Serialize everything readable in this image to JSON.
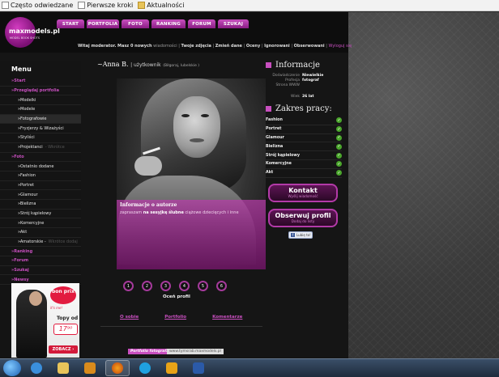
{
  "bookmarks": [
    {
      "label": "Często odwiedzane",
      "icon": "page-icon"
    },
    {
      "label": "Pierwsze kroki",
      "icon": "page-icon"
    },
    {
      "label": "Aktualności",
      "icon": "folder-icon"
    }
  ],
  "logo": {
    "text": "maxmodels.pl",
    "sub": "MODEL BOOK SHOTS"
  },
  "topnav": [
    "START",
    "PORTFOLIA",
    "FOTO",
    "RANKING",
    "FORUM",
    "SZUKAJ"
  ],
  "userbar": {
    "greeting": "Witaj moderator.",
    "msg": "Masz 0 nowych",
    "msg_link": "wiadomości",
    "links": [
      "Twoje zdjęcia",
      "Zmień dane",
      "Oceny",
      "Ignorowani",
      "Obserwowani"
    ],
    "logout": "Wyloguj się"
  },
  "sidebar": {
    "title": "Menu",
    "items": [
      {
        "label": "»Start",
        "type": "sec"
      },
      {
        "label": "»Przeglądaj portfolia",
        "type": "sec"
      },
      {
        "label": "»Modelki",
        "type": "sub"
      },
      {
        "label": "»Modele",
        "type": "sub"
      },
      {
        "label": "»Fotografowie",
        "type": "sub"
      },
      {
        "label": "»Fryzjerzy & Wizażyści",
        "type": "sub"
      },
      {
        "label": "»Styliści",
        "type": "sub"
      },
      {
        "label": "»Projektanci",
        "type": "sub",
        "note": "- Wkrótce"
      },
      {
        "label": "»Foto",
        "type": "sec"
      },
      {
        "label": "»Ostatnio dodane",
        "type": "sub2"
      },
      {
        "label": "»Fashion",
        "type": "sub2"
      },
      {
        "label": "»Portret",
        "type": "sub2"
      },
      {
        "label": "»Glamour",
        "type": "sub2"
      },
      {
        "label": "»Bielizna",
        "type": "sub2"
      },
      {
        "label": "»Strój kąpielowy",
        "type": "sub2"
      },
      {
        "label": "»Komercyjne",
        "type": "sub2"
      },
      {
        "label": "»Akt",
        "type": "sub2"
      },
      {
        "label": "»Amatorskie -",
        "type": "sub2",
        "note": "Wkrótce dodaj"
      },
      {
        "label": "»Ranking",
        "type": "sec"
      },
      {
        "label": "»Forum",
        "type": "sec"
      },
      {
        "label": "»Szukaj",
        "type": "sec"
      },
      {
        "label": "»Newsy",
        "type": "sec"
      }
    ]
  },
  "ad": {
    "brand": "bon prix",
    "tagline": "it's me!",
    "label": "Topy",
    "prefix": "od",
    "price": "17⁹⁰",
    "cta": "ZOBACZ ›"
  },
  "profile": {
    "name": "~Anna B.",
    "role": "| użytkownik",
    "location": "(Biłgoraj, lubelskie )",
    "overlay_title": "Informacje o autorze",
    "overlay_text_a": "zapraszam",
    "overlay_text_b": "na sesyjkę",
    "overlay_text_c": "ślubne",
    "overlay_text_d": "ciążowe dziecięcych i inne",
    "ratings": [
      "1",
      "2",
      "3",
      "4",
      "5",
      "6"
    ],
    "rate_label": "Oceń profil",
    "links": [
      "O sobie",
      "Portfolio",
      "Komentarze"
    ],
    "portfolio_label": "Portfolio fotografa",
    "portfolio_url": "www.tymsrab.maxmodels.pl"
  },
  "info": {
    "title": "Informacje",
    "rows": [
      {
        "k": "Doświadczenie",
        "v": "Niewielkie"
      },
      {
        "k": "Profesja",
        "v": "fotograf"
      },
      {
        "k": "Strona WWW",
        "v": ""
      },
      {
        "k": "Wiek",
        "v": "26 lat"
      }
    ]
  },
  "scope": {
    "title": "Zakres prac",
    "title_suffix": "y:",
    "items": [
      "Fashion",
      "Portret",
      "Glamour",
      "Bielizna",
      "Strój kąpielowy",
      "Komercyjne",
      "Akt"
    ]
  },
  "buttons": {
    "contact": {
      "title": "Kontakt",
      "sub": "Wyślij wiadomość"
    },
    "watch": {
      "title": "Obserwuj profil",
      "sub": "Dodaj do listy"
    },
    "fb": "Lubię to!"
  },
  "colors": {
    "accent": "#c84fbf",
    "background": "#151515",
    "check": "#4aa62b"
  }
}
